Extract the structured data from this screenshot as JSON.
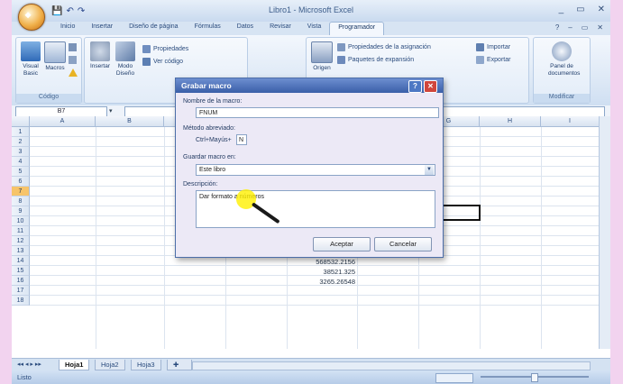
{
  "window": {
    "title": "Libro1 - Microsoft Excel",
    "controls": [
      "_",
      "▭",
      "✕"
    ]
  },
  "ribbon": {
    "tabs": [
      "Inicio",
      "Insertar",
      "Diseño de página",
      "Fórmulas",
      "Datos",
      "Revisar",
      "Vista",
      "Programador"
    ],
    "active_tab": "Programador",
    "groups": {
      "codigo": {
        "label": "Código",
        "visual_basic": "Visual Basic",
        "macros": "Macros"
      },
      "controles": {
        "insertar": "Insertar",
        "modo_diseno": "Modo Diseño",
        "propiedades": "Propiedades",
        "ver_codigo": "Ver código"
      },
      "xml": {
        "origen": "Origen",
        "propiedades_asignacion": "Propiedades de la asignación",
        "paquetes_expansion": "Paquetes de expansión",
        "importar": "Importar",
        "exportar": "Exportar"
      },
      "modificar": {
        "label": "Modificar",
        "panel_documentos": "Panel de documentos"
      }
    }
  },
  "formula_bar": {
    "name_box": "B7",
    "formula": ""
  },
  "sheet": {
    "columns": [
      "A",
      "B",
      "C",
      "D",
      "E",
      "F",
      "G",
      "H",
      "I"
    ],
    "rows": [
      "1",
      "2",
      "3",
      "4",
      "5",
      "6",
      "7",
      "8",
      "9",
      "10",
      "11",
      "12",
      "13",
      "14",
      "15",
      "16",
      "17",
      "18"
    ],
    "selected_row": "7",
    "cells": [
      {
        "row": "11",
        "value": "568532.2156"
      },
      {
        "row": "12",
        "value": "38521.325"
      },
      {
        "row": "13",
        "value": "3265.26548"
      }
    ]
  },
  "sheet_tabs": [
    "Hoja1",
    "Hoja2",
    "Hoja3"
  ],
  "active_sheet": "Hoja1",
  "status": {
    "mode": "Listo"
  },
  "dialog": {
    "title": "Grabar macro",
    "nombre_label": "Nombre de la macro:",
    "nombre_value": "FNUM",
    "atajo_label": "Método abreviado:",
    "atajo_prefix": "Ctrl+Mayús+",
    "atajo_value": "N",
    "guardar_label": "Guardar macro en:",
    "guardar_value": "Este libro",
    "descripcion_label": "Descripción:",
    "descripcion_value": "Dar formato a números",
    "accept_label": "Aceptar",
    "cancel_label": "Cancelar",
    "help_label": "?",
    "close_label": "✕"
  }
}
